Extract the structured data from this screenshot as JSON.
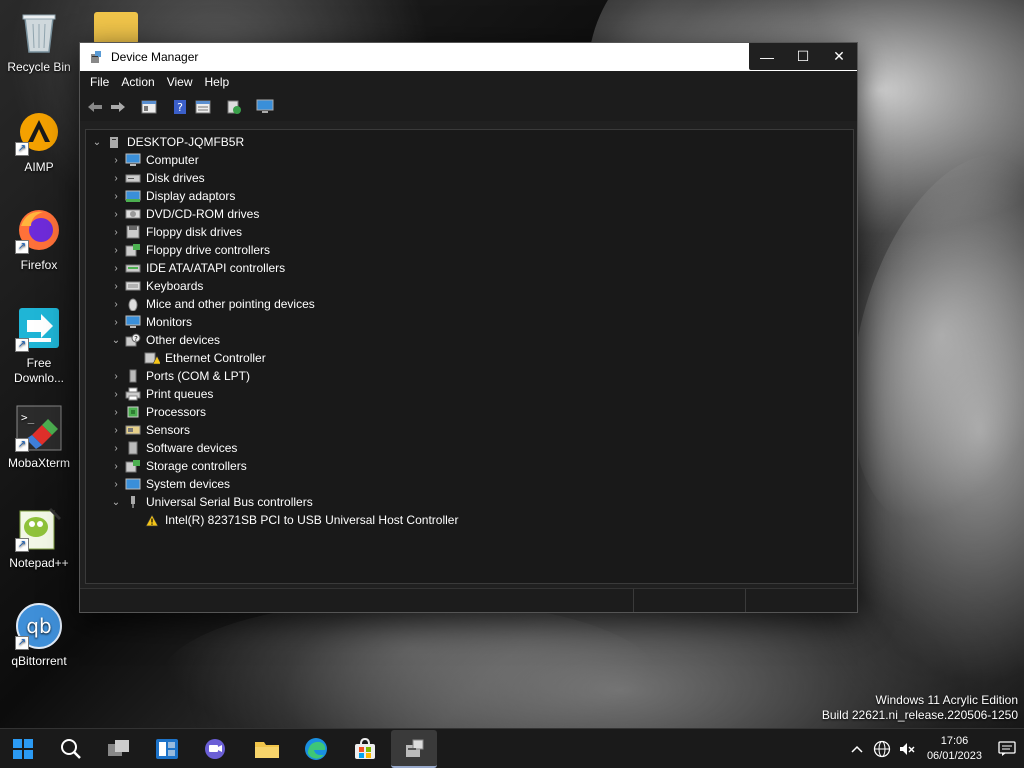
{
  "desktop": {
    "icons": [
      {
        "label": "Recycle Bin"
      },
      {
        "label": "AIMP"
      },
      {
        "label": "Firefox"
      },
      {
        "label": "Free Downlo..."
      },
      {
        "label": "MobaXterm"
      },
      {
        "label": "Notepad++"
      },
      {
        "label": "qBittorrent"
      }
    ]
  },
  "window": {
    "title": "Device Manager",
    "minimize": "—",
    "maximize": "☐",
    "close": "✕"
  },
  "menu": {
    "file": "File",
    "action": "Action",
    "view": "View",
    "help": "Help"
  },
  "tree": {
    "root": "DESKTOP-JQMFB5R",
    "items": [
      {
        "label": "Computer"
      },
      {
        "label": "Disk drives"
      },
      {
        "label": "Display adaptors"
      },
      {
        "label": "DVD/CD-ROM drives"
      },
      {
        "label": "Floppy disk drives"
      },
      {
        "label": "Floppy drive controllers"
      },
      {
        "label": "IDE ATA/ATAPI controllers"
      },
      {
        "label": "Keyboards"
      },
      {
        "label": "Mice and other pointing devices"
      },
      {
        "label": "Monitors"
      },
      {
        "label": "Other devices"
      },
      {
        "label": "Ethernet Controller"
      },
      {
        "label": "Ports (COM & LPT)"
      },
      {
        "label": "Print queues"
      },
      {
        "label": "Processors"
      },
      {
        "label": "Sensors"
      },
      {
        "label": "Software devices"
      },
      {
        "label": "Storage controllers"
      },
      {
        "label": "System devices"
      },
      {
        "label": "Universal Serial Bus controllers"
      },
      {
        "label": "Intel(R) 82371SB PCI to USB Universal Host Controller"
      }
    ]
  },
  "watermark": {
    "line1": "Windows 11 Acrylic Edition",
    "line2": "Build 22621.ni_release.220506-1250"
  },
  "clock": {
    "time": "17:06",
    "date": "06/01/2023"
  },
  "colors": {
    "accent": "#0078d4",
    "warning": "#f5c518"
  }
}
